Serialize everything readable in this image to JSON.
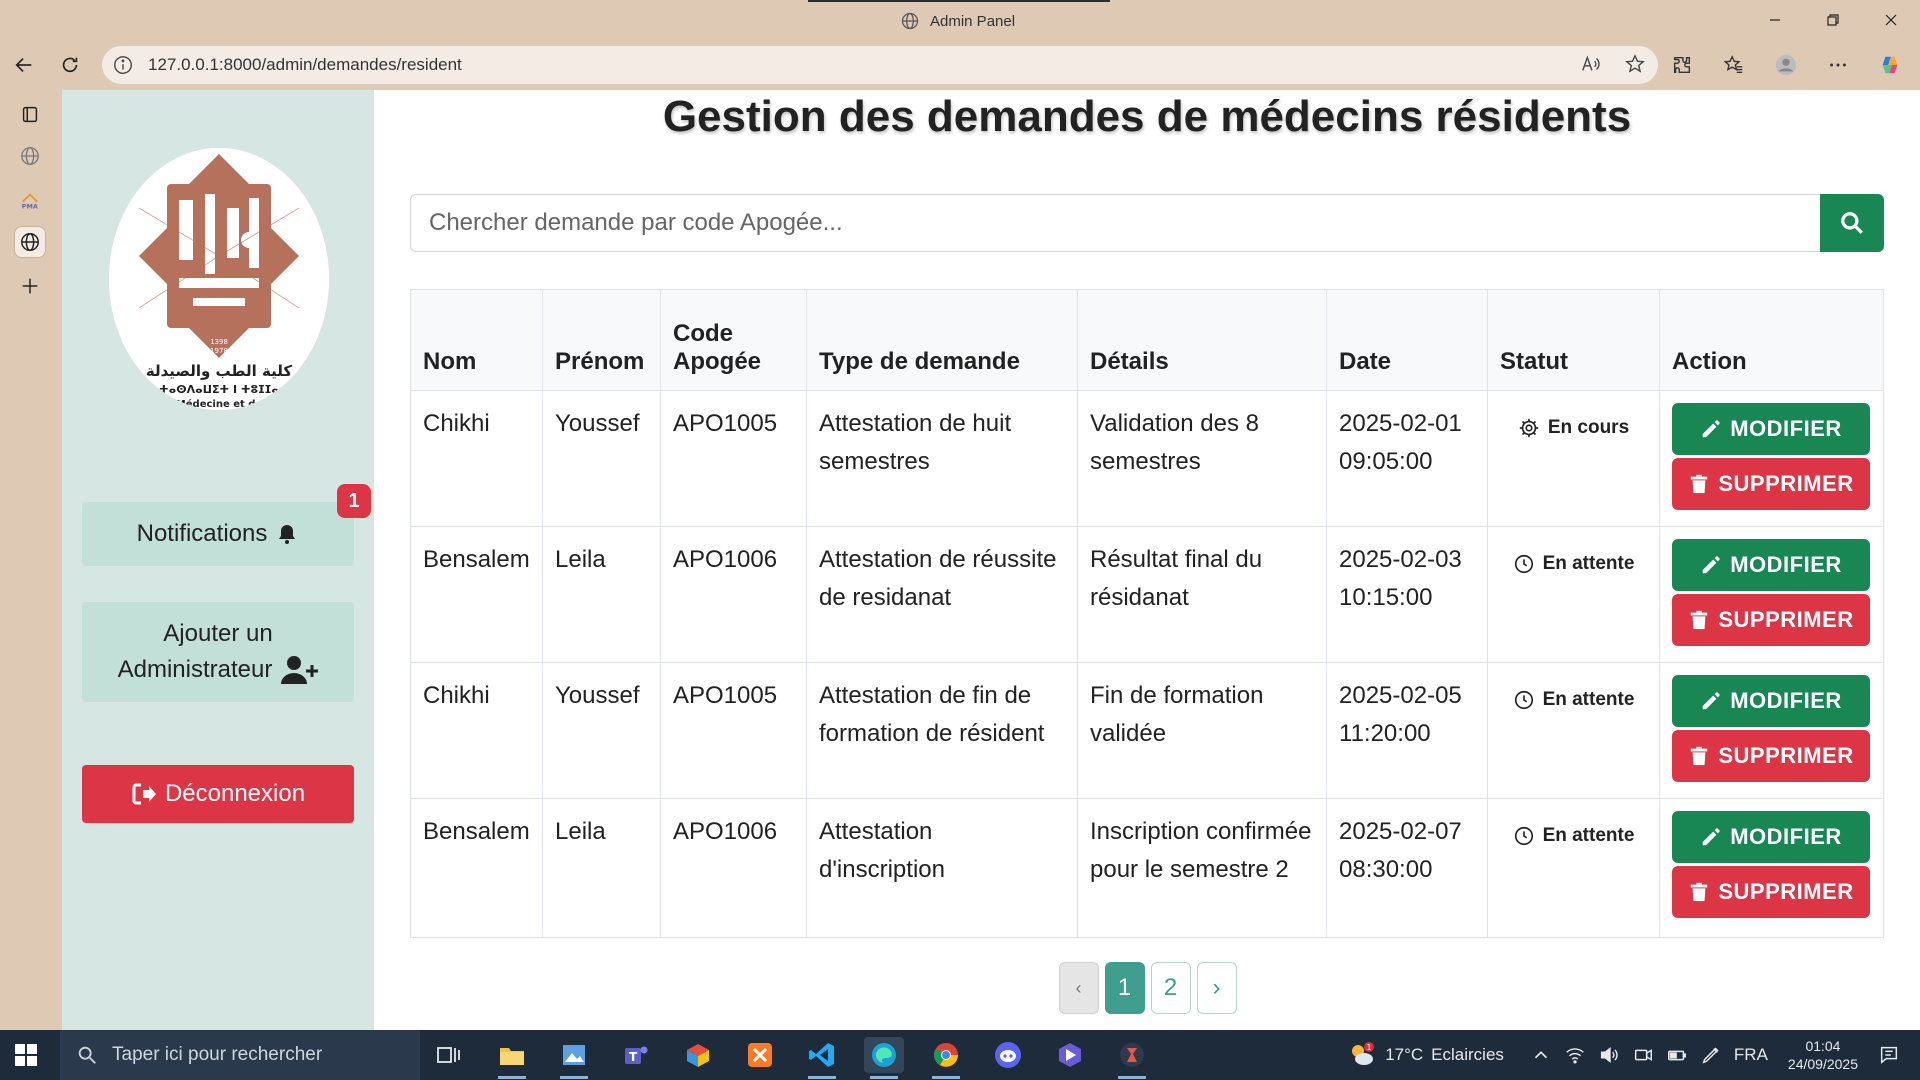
{
  "browser": {
    "window_title": "Admin Panel",
    "url": "127.0.0.1:8000/admin/demandes/resident"
  },
  "page": {
    "title": "Gestion des demandes de médecins résidents",
    "logo_text": {
      "arabic": "كلية الطب والصيدلة",
      "tifinagh": "ⵜⴰⵙⴷⴰⵡⵉⵜ ⵏ ⵜⵓⵊⵊⴰ",
      "french": "Médecine et de",
      "years": [
        "1398",
        "1978"
      ]
    },
    "sidebar": {
      "notifications_label": "Notifications",
      "notifications_count": "1",
      "add_admin_line1": "Ajouter un",
      "add_admin_line2": "Administrateur",
      "logout_label": "Déconnexion"
    },
    "search": {
      "placeholder": "Chercher demande par code Apogée..."
    },
    "table": {
      "headers": [
        "Nom",
        "Prénom",
        "Code Apogée",
        "Type de demande",
        "Détails",
        "Date",
        "Statut",
        "Action"
      ],
      "rows": [
        {
          "nom": "Chikhi",
          "prenom": "Youssef",
          "code": "APO1005",
          "type": "Attestation de huit semestres",
          "details": "Validation des 8 semestres",
          "date": "2025-02-01",
          "time": "09:05:00",
          "statut": "En cours",
          "statut_icon": "gear-icon"
        },
        {
          "nom": "Bensalem",
          "prenom": "Leila",
          "code": "APO1006",
          "type": "Attestation de réussite de residanat",
          "details": "Résultat final du résidanat",
          "date": "2025-02-03",
          "time": "10:15:00",
          "statut": "En attente",
          "statut_icon": "clock-icon"
        },
        {
          "nom": "Chikhi",
          "prenom": "Youssef",
          "code": "APO1005",
          "type": "Attestation de fin de formation de résident",
          "details": "Fin de formation validée",
          "date": "2025-02-05",
          "time": "11:20:00",
          "statut": "En attente",
          "statut_icon": "clock-icon"
        },
        {
          "nom": "Bensalem",
          "prenom": "Leila",
          "code": "APO1006",
          "type": "Attestation d'inscription",
          "details": "Inscription confirmée pour le semestre 2",
          "date": "2025-02-07",
          "time": "08:30:00",
          "statut": "En attente",
          "statut_icon": "clock-icon"
        }
      ],
      "edit_label": "MODIFIER",
      "delete_label": "SUPPRIMER"
    },
    "pagination": {
      "prev": "‹",
      "pages": [
        "1",
        "2"
      ],
      "current": "1",
      "next": "›"
    }
  },
  "taskbar": {
    "search_placeholder": "Taper ici pour rechercher",
    "weather_temp": "17°C",
    "weather_desc": "Eclaircies",
    "weather_badge": "1",
    "language": "FRA",
    "time": "01:04",
    "date": "24/09/2025"
  },
  "colors": {
    "sidebar_bg": "#d6e6e2",
    "sidebar_button": "#c2dfd8",
    "success": "#198754",
    "danger": "#dc3545",
    "pagination_active": "#3f9e8d",
    "browser_chrome": "#ddc9b4",
    "logo_brown": "#b5715c"
  }
}
